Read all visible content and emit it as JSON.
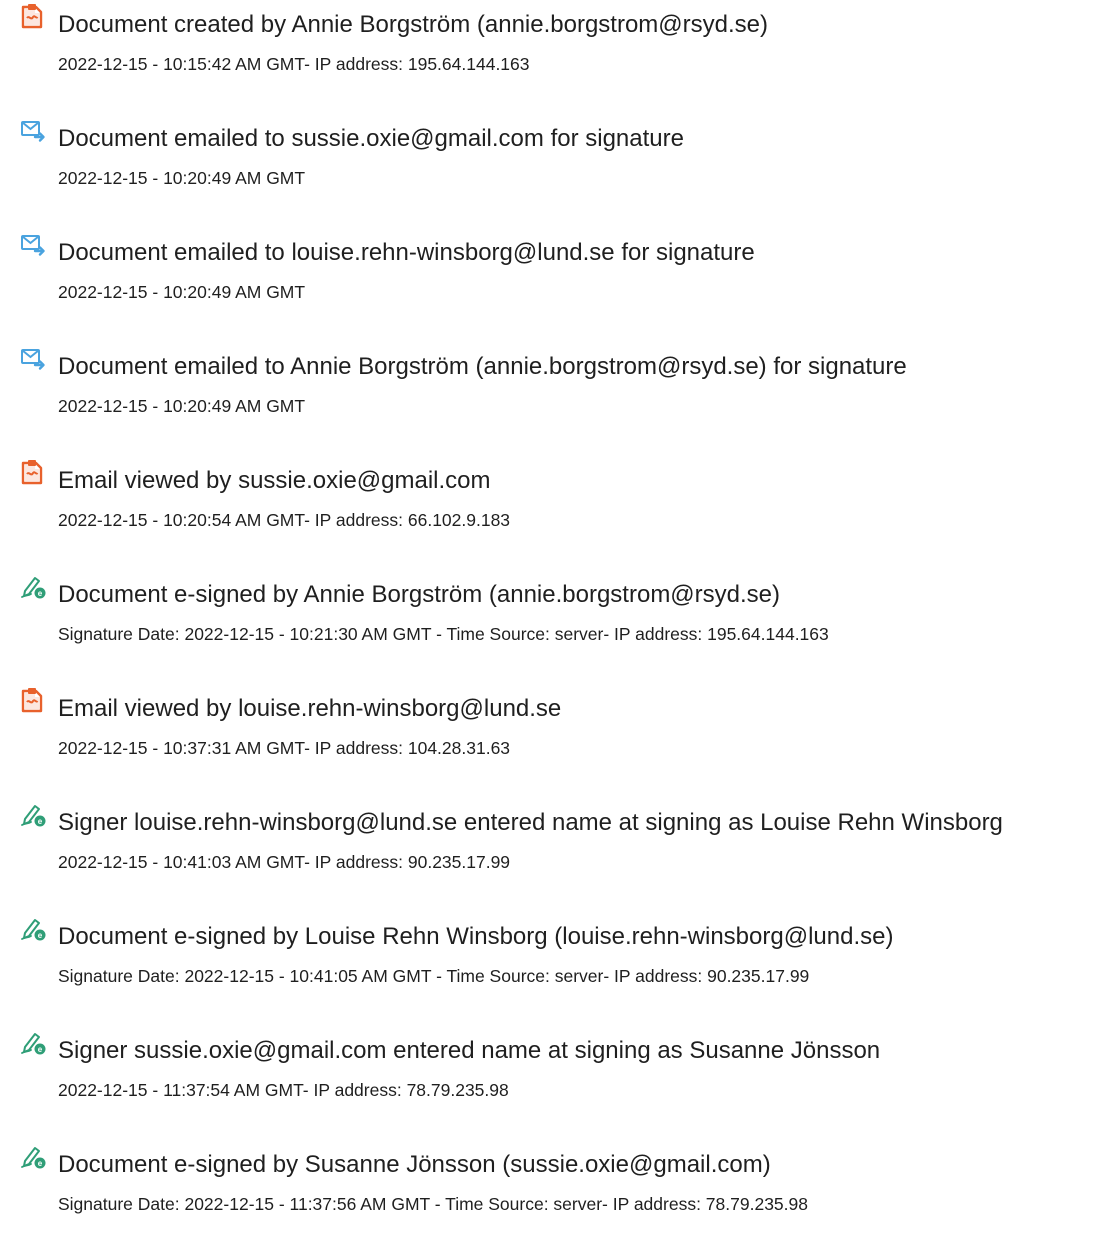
{
  "colors": {
    "doc_icon": "#e8612c",
    "email_icon": "#4aa3df",
    "sign_icon": "#2f9e77",
    "text": "#1f1f1f",
    "background": "#ffffff"
  },
  "events": [
    {
      "icon": "document-icon",
      "title": "Document created by Annie Borgström (annie.borgstrom@rsyd.se)",
      "detail": "2022-12-15 - 10:15:42 AM GMT- IP address: 195.64.144.163"
    },
    {
      "icon": "email-sent-icon",
      "title": "Document emailed to sussie.oxie@gmail.com for signature",
      "detail": "2022-12-15 - 10:20:49 AM GMT"
    },
    {
      "icon": "email-sent-icon",
      "title": "Document emailed to louise.rehn-winsborg@lund.se for signature",
      "detail": "2022-12-15 - 10:20:49 AM GMT"
    },
    {
      "icon": "email-sent-icon",
      "title": "Document emailed to Annie Borgström (annie.borgstrom@rsyd.se) for signature",
      "detail": "2022-12-15 - 10:20:49 AM GMT"
    },
    {
      "icon": "document-icon",
      "title": "Email viewed by sussie.oxie@gmail.com",
      "detail": "2022-12-15 - 10:20:54 AM GMT- IP address: 66.102.9.183"
    },
    {
      "icon": "esign-pen-icon",
      "title": "Document e-signed by Annie Borgström (annie.borgstrom@rsyd.se)",
      "detail": "Signature Date: 2022-12-15 - 10:21:30 AM GMT - Time Source: server- IP address: 195.64.144.163"
    },
    {
      "icon": "document-icon",
      "title": "Email viewed by louise.rehn-winsborg@lund.se",
      "detail": "2022-12-15 - 10:37:31 AM GMT- IP address: 104.28.31.63"
    },
    {
      "icon": "esign-pen-icon",
      "title": "Signer louise.rehn-winsborg@lund.se entered name at signing as Louise Rehn Winsborg",
      "detail": "2022-12-15 - 10:41:03 AM GMT- IP address: 90.235.17.99"
    },
    {
      "icon": "esign-pen-icon",
      "title": "Document e-signed by Louise Rehn Winsborg (louise.rehn-winsborg@lund.se)",
      "detail": "Signature Date: 2022-12-15 - 10:41:05 AM GMT - Time Source: server- IP address: 90.235.17.99"
    },
    {
      "icon": "esign-pen-icon",
      "title": "Signer sussie.oxie@gmail.com entered name at signing as Susanne Jönsson",
      "detail": "2022-12-15 - 11:37:54 AM GMT- IP address: 78.79.235.98"
    },
    {
      "icon": "esign-pen-icon",
      "title": "Document e-signed by Susanne Jönsson (sussie.oxie@gmail.com)",
      "detail": "Signature Date: 2022-12-15 - 11:37:56 AM GMT - Time Source: server- IP address: 78.79.235.98"
    }
  ]
}
